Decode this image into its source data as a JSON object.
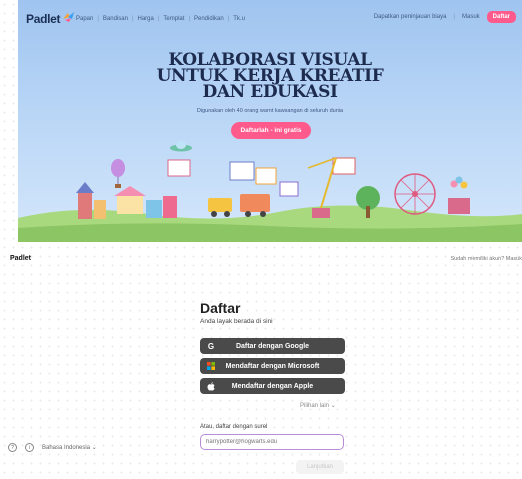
{
  "nav": {
    "logo": "Padlet",
    "links": [
      "Papan",
      "Bandisan",
      "Harga",
      "Templat",
      "Pendidikan",
      "Tk.u"
    ],
    "right_link": "Dapatkan peninjauan biaya",
    "login": "Masuk",
    "signup": "Daftar"
  },
  "hero": {
    "headline": [
      "KOLABORASI VISUAL",
      "UNTUK KERJA KREATIF",
      "DAN EDUKASI"
    ],
    "subline": "Digunakan oleh 40 orang warnt kawsangan di seluruh dunia",
    "cta": "Daftarlah - ini gratis"
  },
  "page": {
    "brand": "Padlet",
    "question": "Sudah memiliki akun? Masuk"
  },
  "form": {
    "title": "Daftar",
    "tagline": "Anda layak berada di sini",
    "google": "Daftar dengan Google",
    "microsoft": "Mendaftar dengan Microsoft",
    "apple": "Mendaftar dengan Apple",
    "more": "Pilihan lain",
    "email_label": "Atau, daftar dengan surel",
    "email_placeholder": "harrypotter@hogwarts.edu",
    "continue": "Lanjutkan"
  },
  "footer": {
    "language": "Bahasa Indonesia"
  },
  "colors": {
    "accent": "#ff5a8c",
    "sso_bg": "#4a4a4a",
    "input_border": "#b98cd9"
  }
}
